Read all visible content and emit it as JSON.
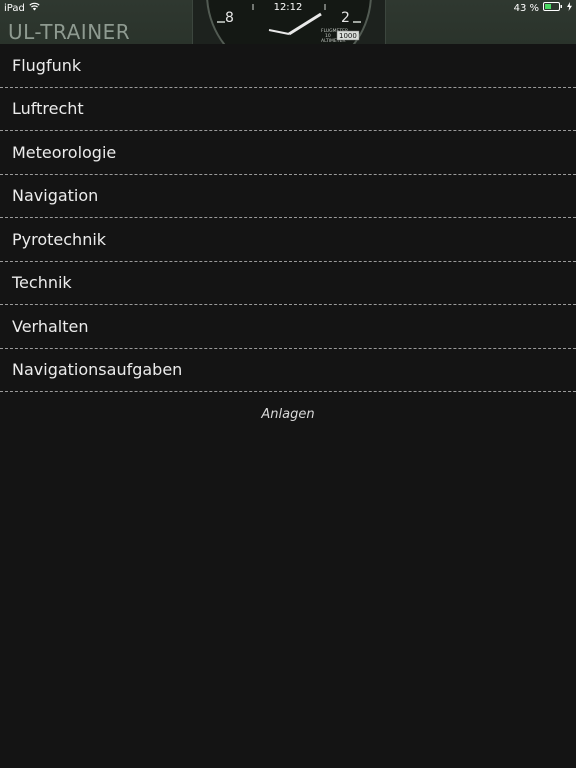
{
  "status_bar": {
    "device": "iPad",
    "time": "12:12",
    "battery": "43 %",
    "icons": [
      "wifi-icon",
      "battery-icon",
      "charging-bolt-icon"
    ]
  },
  "header": {
    "title": "UL-TRAINER",
    "gauge": {
      "dial_left": "8",
      "dial_right": "2",
      "window": "1000",
      "labels": [
        "FLUGMETER",
        "10",
        "ALTIMETER"
      ]
    }
  },
  "menu": {
    "items": [
      {
        "label": "Flugfunk"
      },
      {
        "label": "Luftrecht"
      },
      {
        "label": "Meteorologie"
      },
      {
        "label": "Navigation"
      },
      {
        "label": "Pyrotechnik"
      },
      {
        "label": "Technik"
      },
      {
        "label": "Verhalten"
      },
      {
        "label": "Navigationsaufgaben"
      }
    ],
    "footer_link": "Anlagen"
  },
  "colors": {
    "background": "#141414",
    "header": "#2f3830",
    "title": "#8e9a90",
    "divider": "#9a9a9a",
    "text": "#ececec"
  }
}
